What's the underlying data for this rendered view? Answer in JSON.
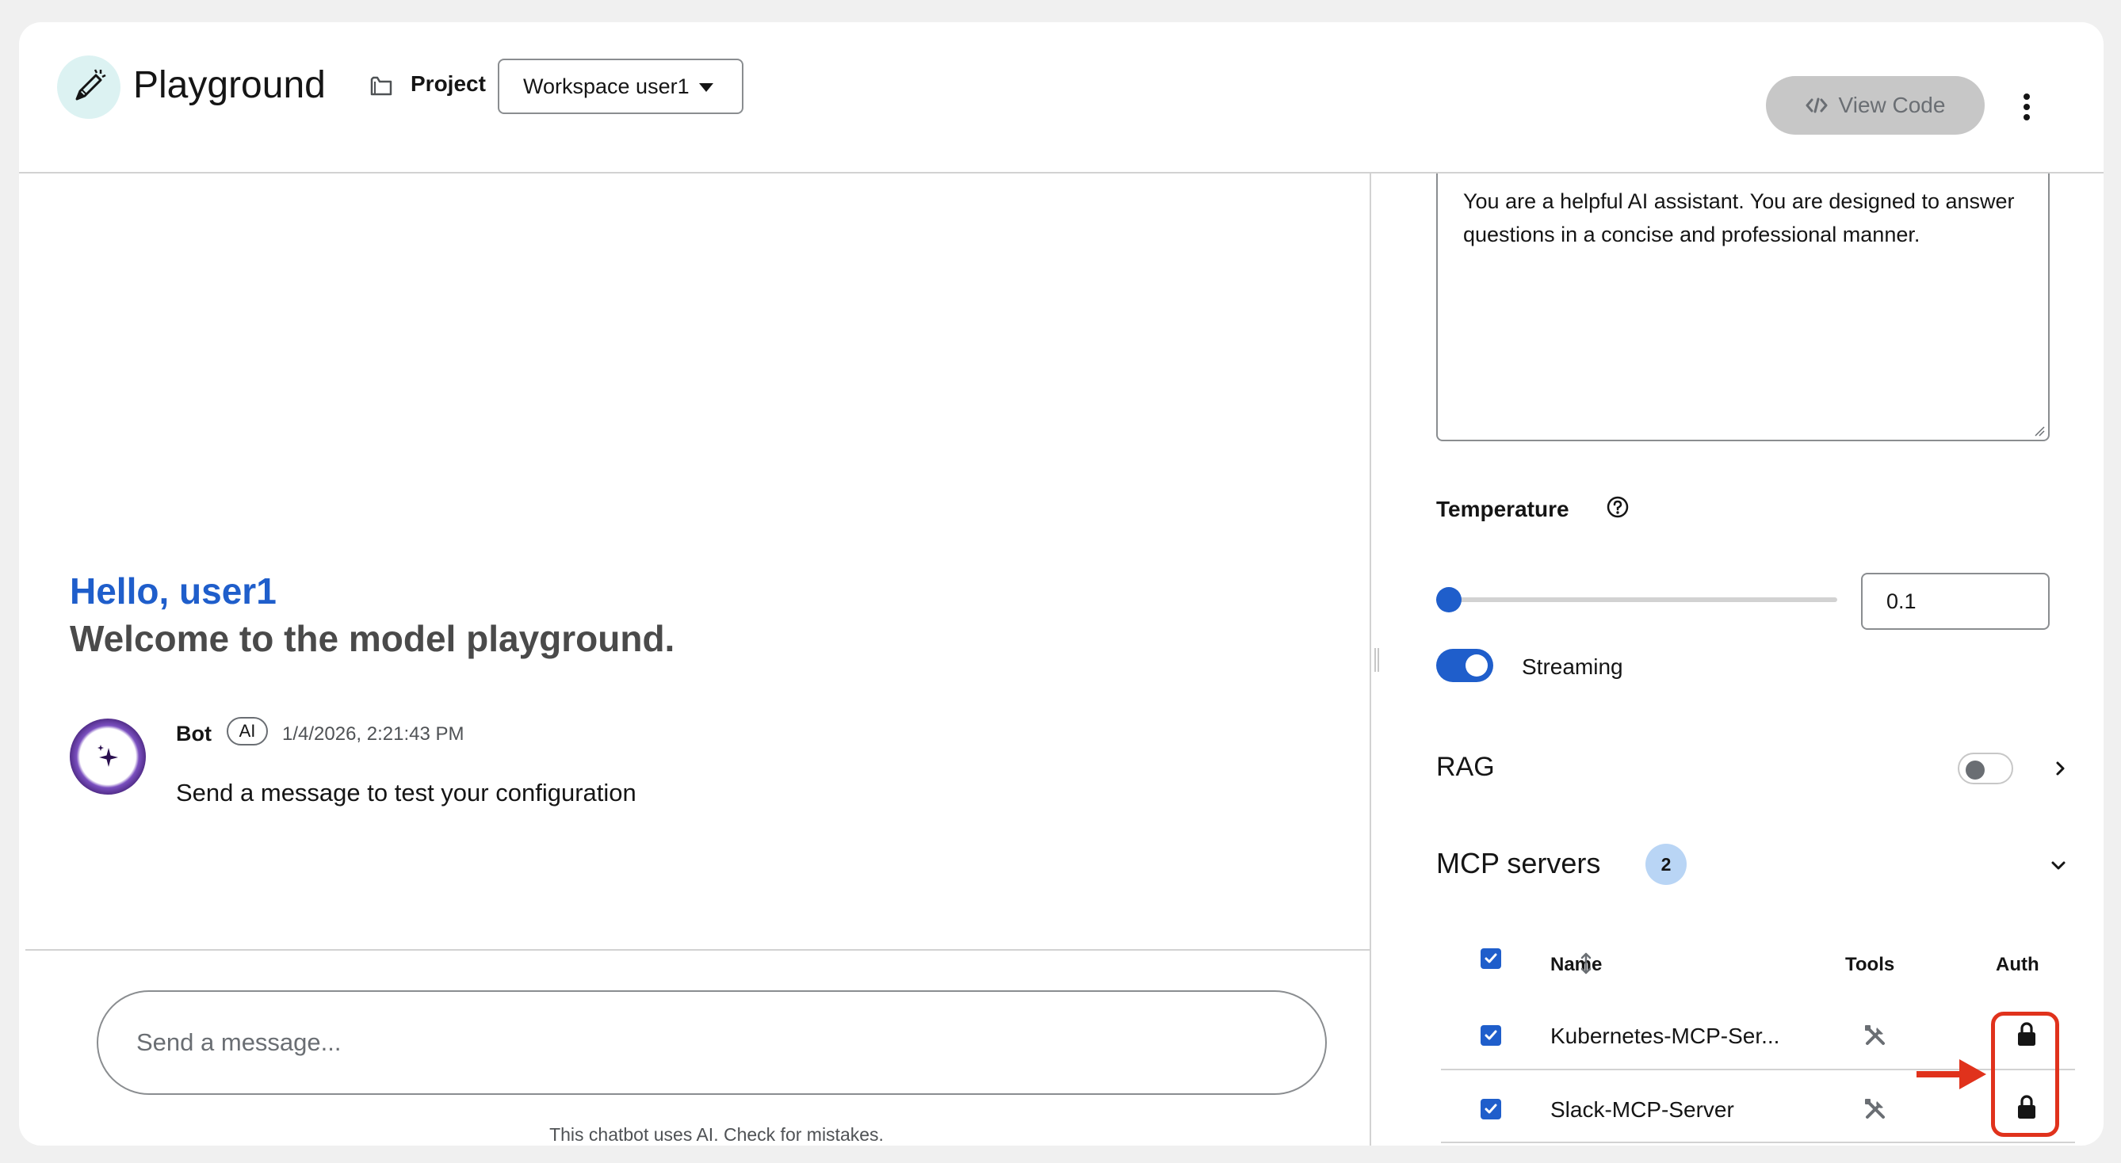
{
  "header": {
    "title": "Playground",
    "project_label": "Project",
    "workspace_value": "Workspace user1",
    "view_code_label": "View Code"
  },
  "chat": {
    "greeting": "Hello, user1",
    "welcome": "Welcome to the model playground.",
    "bot_name": "Bot",
    "ai_badge": "AI",
    "timestamp": "1/4/2026, 2:21:43 PM",
    "bot_message": "Send a message to test your configuration",
    "input_placeholder": "Send a message...",
    "disclaimer": "This chatbot uses AI. Check for mistakes."
  },
  "settings": {
    "system_prompt": "You are a helpful AI assistant. You are designed to answer questions in a concise and professional manner.",
    "temperature_label": "Temperature",
    "temperature_value": "0.1",
    "temperature_fraction": 0.1,
    "streaming_label": "Streaming",
    "streaming_enabled": true,
    "rag_label": "RAG",
    "rag_enabled": false,
    "mcp_label": "MCP servers",
    "mcp_count": "2",
    "table": {
      "headers": {
        "name": "Name",
        "tools": "Tools",
        "auth": "Auth"
      },
      "rows": [
        {
          "name": "Kubernetes-MCP-Ser...",
          "checked": true,
          "tools_icon": "tools-icon",
          "auth_icon": "lock-icon"
        },
        {
          "name": "Slack-MCP-Server",
          "checked": true,
          "tools_icon": "tools-icon",
          "auth_icon": "lock-icon"
        }
      ]
    }
  },
  "colors": {
    "accent": "#1f5ecb",
    "highlight": "#e0321c",
    "badge": "#b9d5f5"
  }
}
